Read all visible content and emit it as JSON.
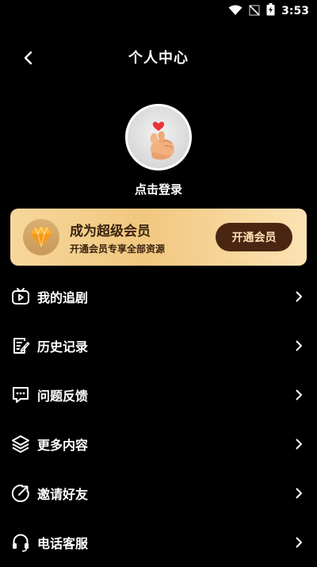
{
  "status_bar": {
    "time": "3:53"
  },
  "header": {
    "title": "个人中心"
  },
  "profile": {
    "login_text": "点击登录"
  },
  "vip": {
    "title": "成为超级会员",
    "subtitle": "开通会员专享全部资源",
    "button_label": "开通会员"
  },
  "menu": {
    "items": [
      {
        "label": "我的追剧",
        "icon": "tv-play-icon"
      },
      {
        "label": "历史记录",
        "icon": "history-note-icon"
      },
      {
        "label": "问题反馈",
        "icon": "feedback-chat-icon"
      },
      {
        "label": "更多内容",
        "icon": "layers-icon"
      },
      {
        "label": "邀请好友",
        "icon": "share-invite-icon"
      },
      {
        "label": "电话客服",
        "icon": "headset-icon"
      }
    ]
  },
  "colors": {
    "background": "#000000",
    "vip_gradient_start": "#f7d79b",
    "vip_gradient_end": "#fbe3b3",
    "vip_button": "#4a2612",
    "vip_text": "#3a2410"
  }
}
